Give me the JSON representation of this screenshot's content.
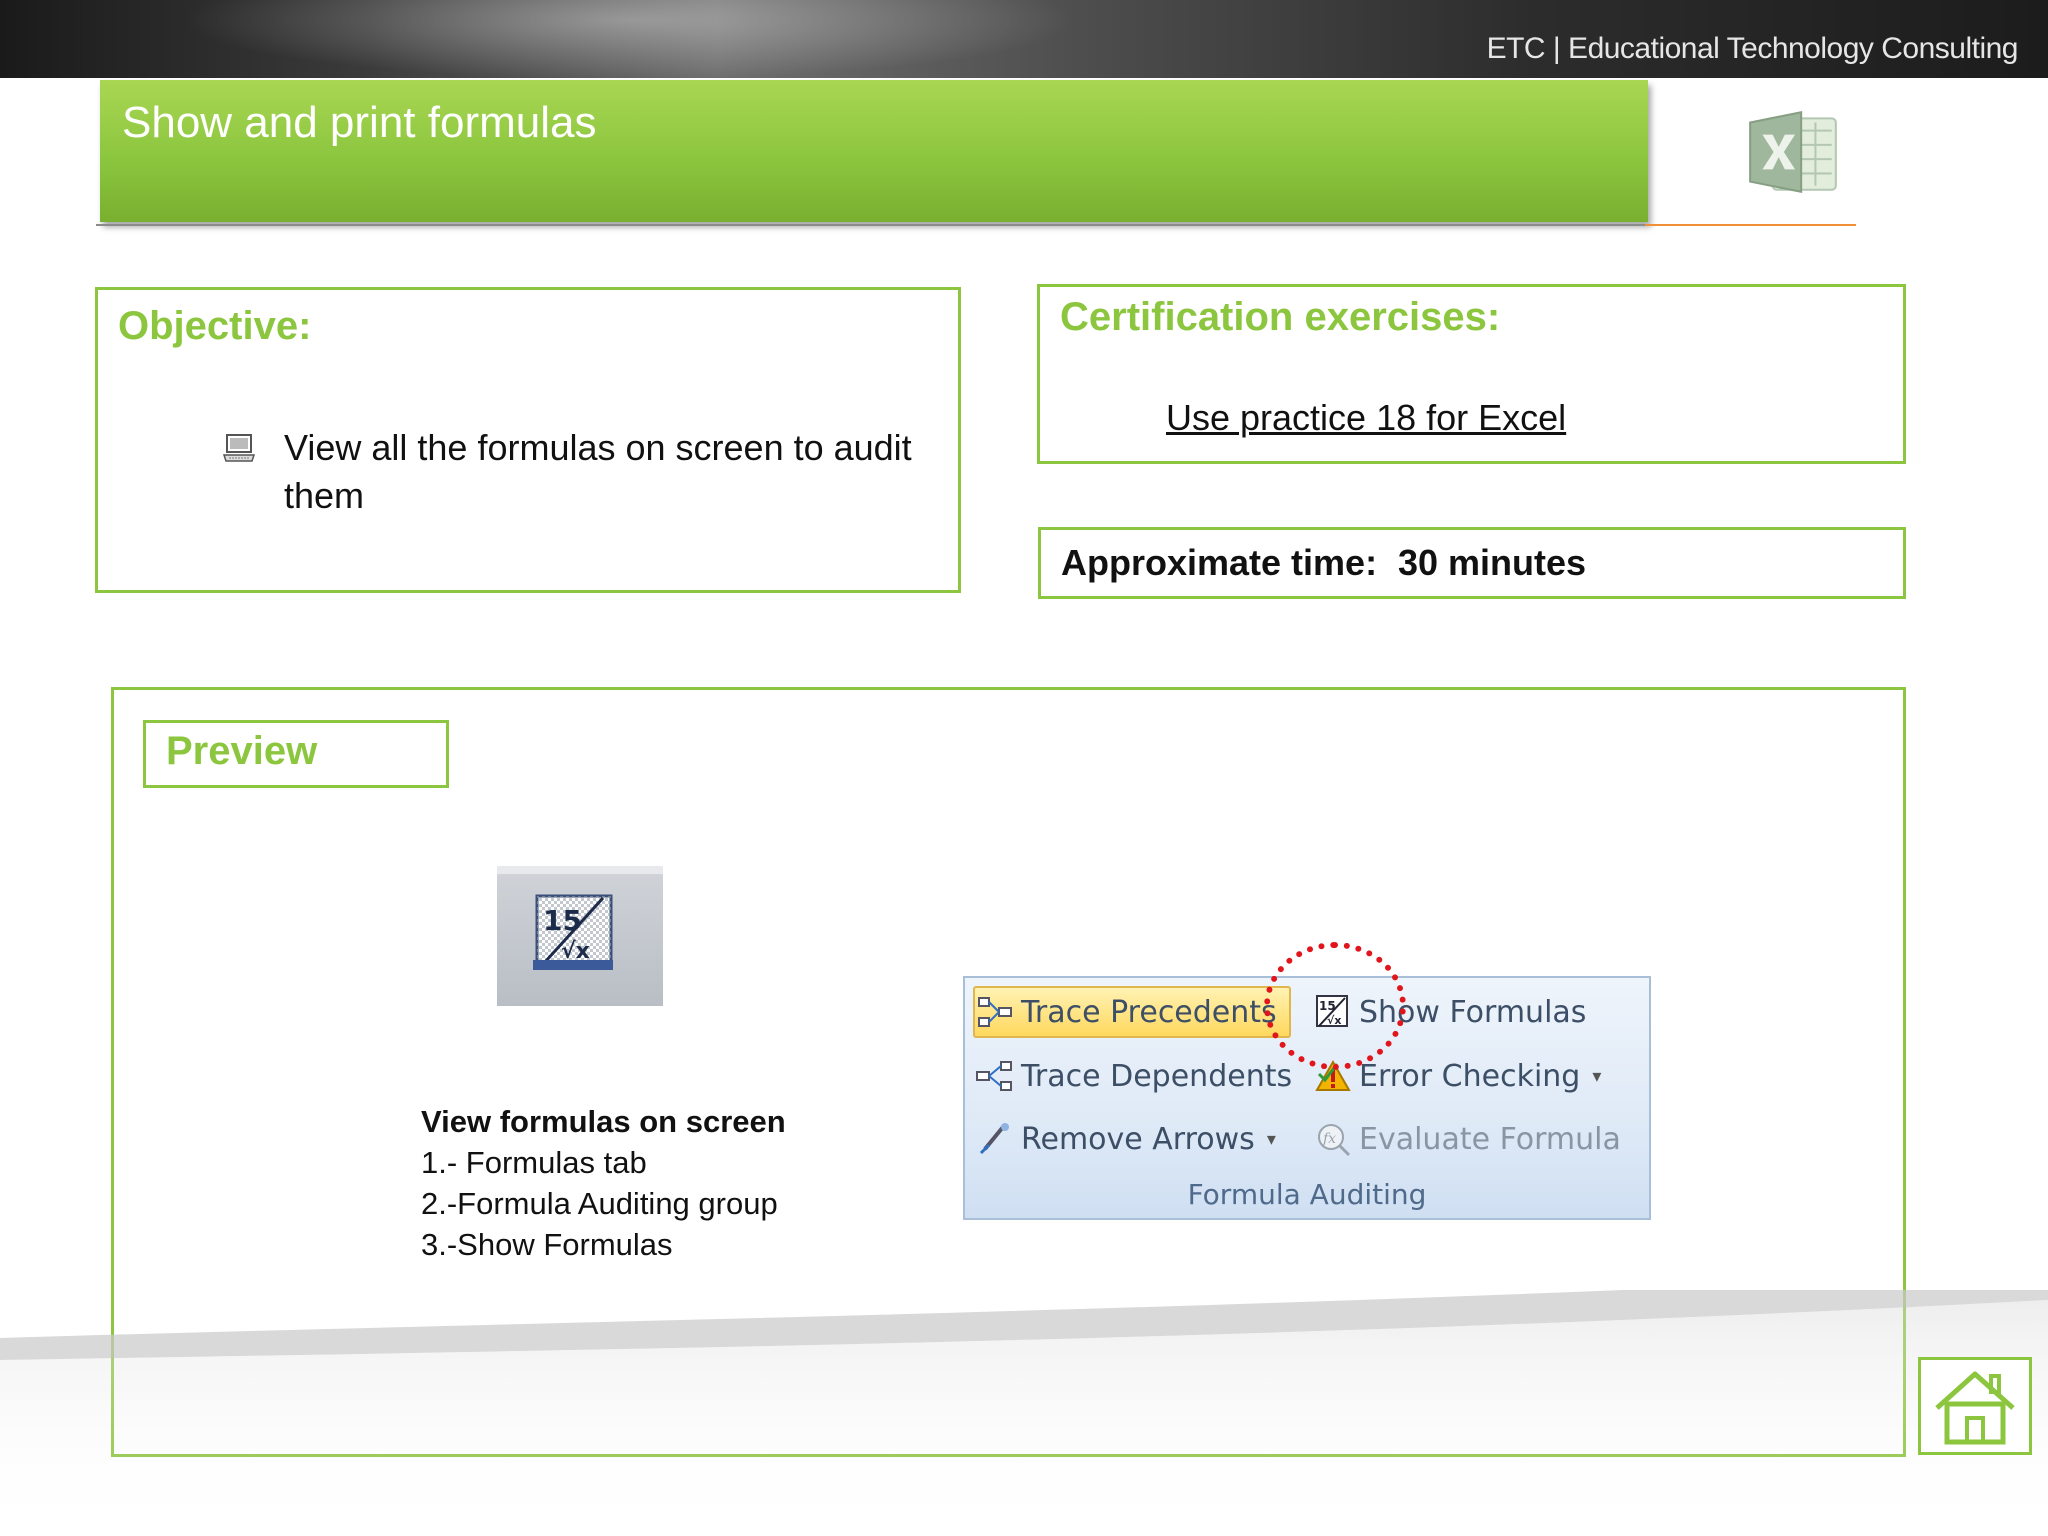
{
  "header": {
    "brand": "ETC | Educational Technology Consulting",
    "title": "Show and print formulas"
  },
  "objective": {
    "heading": "Objective:",
    "bullet_icon": "computer-icon",
    "text": "View all the formulas on screen to audit them"
  },
  "certification": {
    "heading": "Certification exercises:",
    "link": "Use practice 18 for Excel"
  },
  "time": {
    "label": "Approximate time:",
    "value": "30 minutes"
  },
  "preview": {
    "heading": "Preview",
    "button_icon": "show-formulas-icon",
    "steps_title": "View formulas on screen",
    "steps": [
      "1.- Formulas tab",
      "2.-Formula Auditing group",
      "3.-Show Formulas"
    ],
    "ribbon": {
      "trace_precedents": "Trace Precedents",
      "trace_dependents": "Trace Dependents",
      "remove_arrows": "Remove Arrows",
      "show_formulas": "Show Formulas",
      "error_checking": "Error Checking",
      "evaluate_formula": "Evaluate Formula",
      "group_label": "Formula Auditing",
      "dropdown_caret": "▾"
    }
  },
  "nav": {
    "home_icon": "home-icon"
  },
  "colors": {
    "accent_green": "#8cc63f",
    "highlight_red": "#e0161c",
    "underline_orange": "#f0913a"
  }
}
